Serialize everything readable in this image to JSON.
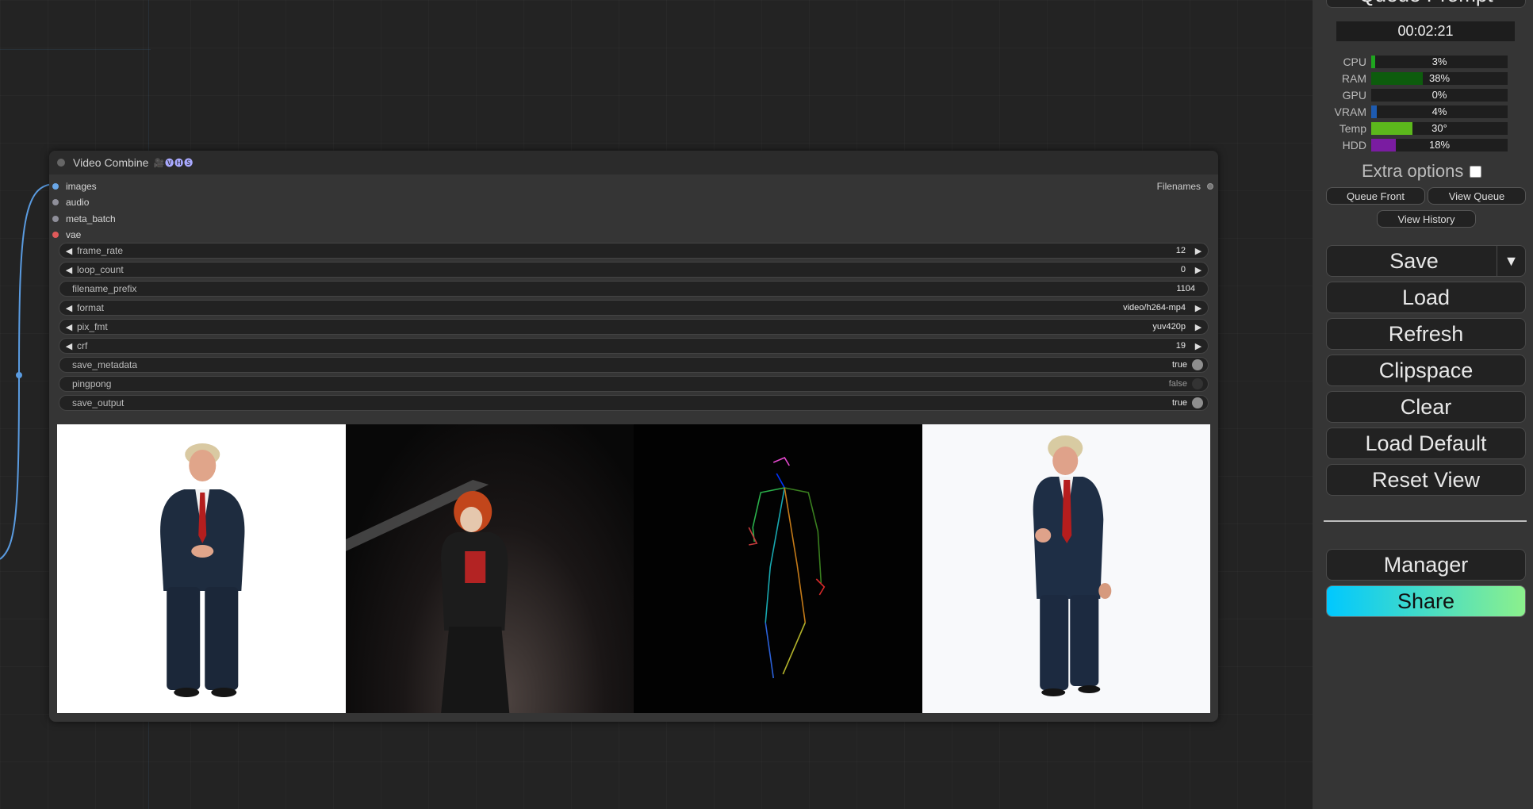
{
  "node": {
    "title": "Video Combine",
    "badge": "🎥🅥🅗🅢",
    "inputs": [
      "images",
      "audio",
      "meta_batch",
      "vae"
    ],
    "output": "Filenames",
    "widgets": [
      {
        "name": "frame_rate",
        "value": "12",
        "arrows": true
      },
      {
        "name": "loop_count",
        "value": "0",
        "arrows": true
      },
      {
        "name": "filename_prefix",
        "value": "1104",
        "arrows": false
      },
      {
        "name": "format",
        "value": "video/h264-mp4",
        "arrows": true
      },
      {
        "name": "pix_fmt",
        "value": "yuv420p",
        "arrows": true
      },
      {
        "name": "crf",
        "value": "19",
        "arrows": true
      },
      {
        "name": "save_metadata",
        "value": "true",
        "toggle": true
      },
      {
        "name": "pingpong",
        "value": "false",
        "toggle": true
      },
      {
        "name": "save_output",
        "value": "true",
        "toggle": true
      }
    ]
  },
  "sidebar": {
    "queue_prompt": "Queue Prompt",
    "timer": "00:02:21",
    "monitors": [
      {
        "label": "CPU",
        "value": "3%",
        "pct": 3,
        "color": "#1fa61f"
      },
      {
        "label": "RAM",
        "value": "38%",
        "pct": 38,
        "color": "#0d5c0d"
      },
      {
        "label": "GPU",
        "value": "0%",
        "pct": 0,
        "color": "#1e5bb0"
      },
      {
        "label": "VRAM",
        "value": "4%",
        "pct": 4,
        "color": "#1e5bb0"
      },
      {
        "label": "Temp",
        "value": "30°",
        "pct": 30,
        "color": "#5cb81c"
      },
      {
        "label": "HDD",
        "value": "18%",
        "pct": 18,
        "color": "#7a1ca1"
      }
    ],
    "extra_options": "Extra options",
    "queue_front": "Queue Front",
    "view_queue": "View Queue",
    "view_history": "View History",
    "save": "Save",
    "save_menu": "▼",
    "load": "Load",
    "refresh": "Refresh",
    "clipspace": "Clipspace",
    "clear": "Clear",
    "load_default": "Load Default",
    "reset_view": "Reset View",
    "manager": "Manager",
    "share": "Share"
  }
}
